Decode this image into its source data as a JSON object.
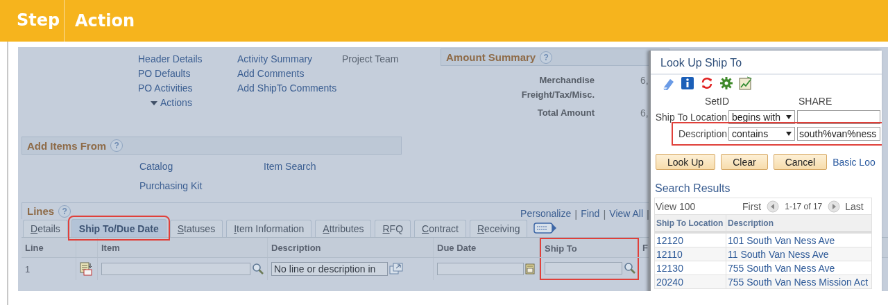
{
  "step_header": {
    "step": "Step",
    "action": "Action"
  },
  "page": {
    "link_columns": [
      [
        "Header Details",
        "PO Defaults",
        "PO Activities"
      ],
      [
        "Activity Summary",
        "Add Comments",
        "Add ShipTo Comments"
      ],
      [
        "Project Team"
      ]
    ],
    "actions_menu": "Actions",
    "amount_summary": {
      "title": "Amount Summary",
      "help": "?",
      "rows": [
        {
          "label": "Merchandise",
          "value": "6,"
        },
        {
          "label": "Freight/Tax/Misc."
        },
        {
          "label": "Total Amount",
          "value": "6,"
        }
      ]
    },
    "add_items_from": {
      "title": "Add Items From",
      "help": "?",
      "links": [
        "Catalog",
        "Item Search",
        "Purchasing Kit"
      ]
    },
    "lines": {
      "title": "Lines",
      "help": "?",
      "nav_items": [
        {
          "kind": "link",
          "text": "Personalize"
        },
        {
          "kind": "separator",
          "text": "|"
        },
        {
          "kind": "link",
          "text": "Find"
        },
        {
          "kind": "separator",
          "text": "|"
        },
        {
          "kind": "link",
          "text": "View All"
        },
        {
          "kind": "separator",
          "text": "|"
        }
      ],
      "tabs": [
        {
          "label": "Details",
          "selected": false,
          "highlighted": false
        },
        {
          "label": "Ship To/Due Date",
          "selected": true,
          "highlighted": true
        },
        {
          "label": "Statuses",
          "selected": false,
          "highlighted": false
        },
        {
          "label": "Item Information",
          "selected": false,
          "highlighted": false
        },
        {
          "label": "Attributes",
          "selected": false,
          "highlighted": false
        },
        {
          "label": "RFQ",
          "selected": false,
          "highlighted": false
        },
        {
          "label": "Contract",
          "selected": false,
          "highlighted": false
        },
        {
          "label": "Receiving",
          "selected": false,
          "highlighted": false
        }
      ],
      "columns": [
        {
          "label": "Line",
          "highlighted": false
        },
        {
          "highlighted": false
        },
        {
          "label": "Item",
          "highlighted": false
        },
        {
          "label": "Description",
          "highlighted": false
        },
        {
          "label": "Due Date",
          "highlighted": false
        },
        {
          "label": "Ship To",
          "highlighted": true
        },
        {
          "label": "F",
          "highlighted": false
        }
      ],
      "rows": [
        {
          "line": "1",
          "description": "No line or description in"
        }
      ]
    }
  },
  "lookup_dialog": {
    "title": "Look Up Ship To",
    "setid_label": "SetID",
    "setid_value": "SHARE",
    "criteria": [
      {
        "label": "Ship To Location",
        "operator": "begins with",
        "highlighted": false
      },
      {
        "label": "Description",
        "operator": "contains",
        "value": "south%van%ness",
        "highlighted": true
      }
    ],
    "buttons": [
      "Look Up",
      "Clear",
      "Cancel"
    ],
    "basic_lookup_link": "Basic Loo",
    "results_title": "Search Results",
    "results_nav": {
      "view": "View 100",
      "first": "First",
      "range": "1-17 of 17",
      "last": "Last"
    },
    "columns": [
      "Ship To Location",
      "Description"
    ],
    "rows": [
      {
        "location": "12120",
        "description": "101 South Van Ness Ave"
      },
      {
        "location": "12110",
        "description": "11 South Van Ness Ave"
      },
      {
        "location": "12130",
        "description": "755 South Van Ness Ave"
      },
      {
        "location": "20240",
        "description": "755 South Van Ness Mission Act"
      }
    ]
  }
}
